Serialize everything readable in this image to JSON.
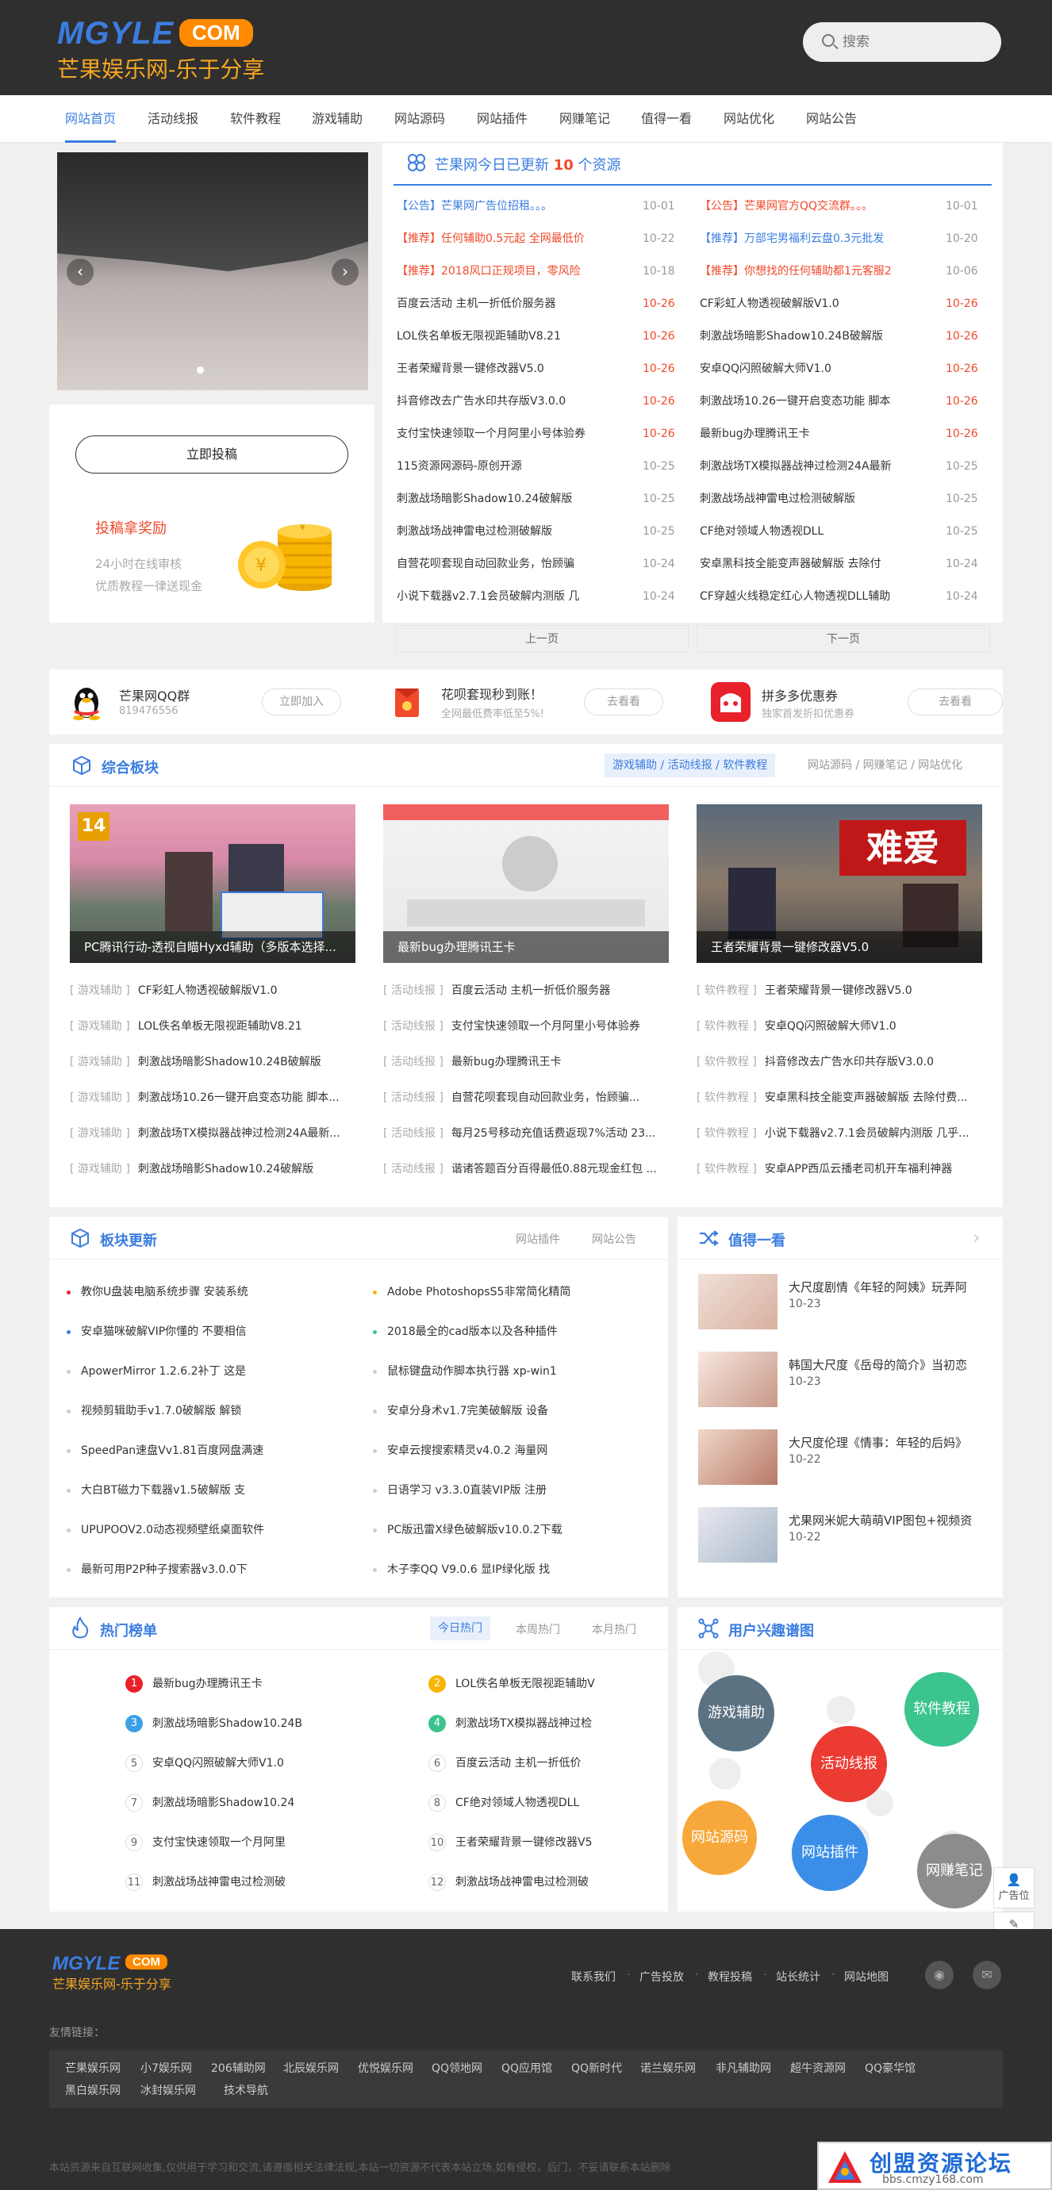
{
  "header": {
    "logo_main": "MGYLE",
    "logo_com": "COM",
    "logo_sub": "芒果娱乐网-乐于分享",
    "search_placeholder": "搜索"
  },
  "nav": [
    "网站首页",
    "活动线报",
    "软件教程",
    "游戏辅助",
    "网站源码",
    "网站插件",
    "网赚笔记",
    "值得一看",
    "网站优化",
    "网站公告"
  ],
  "submit": {
    "button": "立即投稿",
    "reward_title": "投稿拿奖励",
    "reward_desc1": "24小时在线审核",
    "reward_desc2": "优质教程一律送现金"
  },
  "updates": {
    "title_pre": "芒果网今日已更新",
    "count": "10",
    "title_post": "个资源",
    "left": [
      {
        "t": "【公告】芒果网广告位招租。。。",
        "d": "10-01",
        "c": "blue"
      },
      {
        "t": "【推荐】任何辅助0.5元起 全网最低价",
        "d": "10-22",
        "c": "red"
      },
      {
        "t": "【推荐】2018风口正规项目，零风险",
        "d": "10-18",
        "c": "red"
      },
      {
        "t": "百度云活动 主机一折低价服务器",
        "d": "10-26",
        "c": "new"
      },
      {
        "t": "LOL佚名单板无限视距辅助V8.21",
        "d": "10-26",
        "c": "new"
      },
      {
        "t": "王者荣耀背景一键修改器V5.0",
        "d": "10-26",
        "c": "new"
      },
      {
        "t": "抖音修改去广告水印共存版V3.0.0",
        "d": "10-26",
        "c": "new"
      },
      {
        "t": "支付宝快速领取一个月阿里小号体验券",
        "d": "10-26",
        "c": "new"
      },
      {
        "t": "115资源网源码-原创开源",
        "d": "10-25",
        "c": "old"
      },
      {
        "t": "刺激战场暗影Shadow10.24破解版",
        "d": "10-25",
        "c": "old"
      },
      {
        "t": "刺激战场战神雷电过检测破解版",
        "d": "10-25",
        "c": "old"
      },
      {
        "t": "自营花呗套现自动回款业务，怡顾骗",
        "d": "10-24",
        "c": "old"
      },
      {
        "t": "小说下载器v2.7.1会员破解内测版 几",
        "d": "10-24",
        "c": "old"
      }
    ],
    "right": [
      {
        "t": "【公告】芒果网官方QQ交流群。。。",
        "d": "10-01",
        "c": "red"
      },
      {
        "t": "【推荐】万部宅男福利云盘0.3元批发",
        "d": "10-20",
        "c": "blue"
      },
      {
        "t": "【推荐】你想找的任何辅助都1元客服2",
        "d": "10-06",
        "c": "red"
      },
      {
        "t": "CF彩虹人物透视破解版V1.0",
        "d": "10-26",
        "c": "new"
      },
      {
        "t": "刺激战场暗影Shadow10.24B破解版",
        "d": "10-26",
        "c": "new"
      },
      {
        "t": "安卓QQ闪照破解大师V1.0",
        "d": "10-26",
        "c": "new"
      },
      {
        "t": "刺激战场10.26一键开启变态功能 脚本",
        "d": "10-26",
        "c": "new"
      },
      {
        "t": "最新bug办理腾讯王卡",
        "d": "10-26",
        "c": "new"
      },
      {
        "t": "刺激战场TX模拟器战神过检测24A最新",
        "d": "10-25",
        "c": "old"
      },
      {
        "t": "刺激战场战神雷电过检测破解版",
        "d": "10-25",
        "c": "old"
      },
      {
        "t": "CF绝对领域人物透视DLL",
        "d": "10-25",
        "c": "old"
      },
      {
        "t": "安卓黑科技全能变声器破解版 去除付",
        "d": "10-24",
        "c": "old"
      },
      {
        "t": "CF穿越火线稳定红心人物透视DLL辅助",
        "d": "10-24",
        "c": "old"
      }
    ],
    "prev": "上一页",
    "next": "下一页"
  },
  "promos": [
    {
      "name": "芒果网QQ群",
      "sub": "819476556",
      "btn": "立即加入"
    },
    {
      "name": "花呗套现秒到账！",
      "sub": "全网最低费率低至5%!",
      "btn": "去看看"
    },
    {
      "name": "拼多多优惠券",
      "sub": "独家首发折扣优惠券",
      "btn": "去看看"
    }
  ],
  "combined": {
    "title": "综合板块",
    "tabs_active": "游戏辅助 / 活动线报 / 软件教程",
    "tabs_other": "网站源码 / 网赚笔记 / 网站优化",
    "thumbs": [
      "PC腾讯行动-透视自瞄Hyxd辅助（多版本选择...",
      "最新bug办理腾讯王卡",
      "王者荣耀背景一键修改器V5.0"
    ],
    "col1": [
      [
        "[ 游戏辅助 ]",
        "CF彩虹人物透视破解版V1.0"
      ],
      [
        "[ 游戏辅助 ]",
        "LOL佚名单板无限视距辅助V8.21"
      ],
      [
        "[ 游戏辅助 ]",
        "刺激战场暗影Shadow10.24B破解版"
      ],
      [
        "[ 游戏辅助 ]",
        "刺激战场10.26一键开启变态功能 脚本..."
      ],
      [
        "[ 游戏辅助 ]",
        "刺激战场TX模拟器战神过检测24A最新..."
      ],
      [
        "[ 游戏辅助 ]",
        "刺激战场暗影Shadow10.24破解版"
      ]
    ],
    "col2": [
      [
        "[ 活动线报 ]",
        "百度云活动 主机一折低价服务器"
      ],
      [
        "[ 活动线报 ]",
        "支付宝快速领取一个月阿里小号体验券"
      ],
      [
        "[ 活动线报 ]",
        "最新bug办理腾讯王卡"
      ],
      [
        "[ 活动线报 ]",
        "自营花呗套现自动回款业务，怡顾骗..."
      ],
      [
        "[ 活动线报 ]",
        "每月25号移动充值话费返现7%活动 23..."
      ],
      [
        "[ 活动线报 ]",
        "谐诸答题百分百得最低0.88元现金红包 ..."
      ]
    ],
    "col3": [
      [
        "[ 软件教程 ]",
        "王者荣耀背景一键修改器V5.0"
      ],
      [
        "[ 软件教程 ]",
        "安卓QQ闪照破解大师V1.0"
      ],
      [
        "[ 软件教程 ]",
        "抖音修改去广告水印共存版V3.0.0"
      ],
      [
        "[ 软件教程 ]",
        "安卓黑科技全能变声器破解版 去除付费..."
      ],
      [
        "[ 软件教程 ]",
        "小说下载器v2.7.1会员破解内测版 几乎..."
      ],
      [
        "[ 软件教程 ]",
        "安卓APP西瓜云播老司机开车福利神器"
      ]
    ]
  },
  "blockupd": {
    "title": "板块更新",
    "tab1": "网站插件",
    "tab2": "网站公告",
    "left": [
      "教你U盘装电脑系统步骤 安装系统",
      "安卓猫咪破解VIP你懂的 不要相信",
      "ApowerMirror 1.2.6.2补丁 这是",
      "视频剪辑助手v1.7.0破解版 解锁",
      "SpeedPan速盘Vv1.81百度网盘满速",
      "大白BT磁力下载器v1.5破解版 支",
      "UPUPOOV2.0动态视频壁纸桌面软件",
      "最新可用P2P种子搜索器v3.0.0下"
    ],
    "right": [
      "Adobe PhotoshopsS5非常简化精简",
      "2018最全的cad版本以及各种插件",
      "鼠标键盘动作脚本执行器 xp-win1",
      "安卓分身术v1.7完美破解版 设备",
      "安卓云搜搜索精灵v4.0.2 海量网",
      "日语学习 v3.3.0直装VIP版 注册",
      "PC版迅雷X绿色破解版v10.0.2下载",
      "木子李QQ V9.0.6 显IP绿化版 找"
    ]
  },
  "worth": {
    "title": "值得一看",
    "items": [
      [
        "大尺度剧情《年轻的阿姨》玩弄阿",
        "10-23"
      ],
      [
        "韩国大尺度《岳母的简介》当初恋",
        "10-23"
      ],
      [
        "大尺度伦理《情事：年轻的后妈》",
        "10-22"
      ],
      [
        "尤果网米妮大萌萌VIP图包+视频资",
        "10-22"
      ]
    ]
  },
  "hot": {
    "title": "热门榜单",
    "tab1": "今日热门",
    "tab2": "本周热门",
    "tab3": "本月热门",
    "items": [
      "最新bug办理腾讯王卡",
      "LOL佚名单板无限视距辅助V",
      "刺激战场暗影Shadow10.24B",
      "刺激战场TX模拟器战神过检",
      "安卓QQ闪照破解大师V1.0",
      "百度云活动 主机一折低价",
      "刺激战场暗影Shadow10.24",
      "CF绝对领域人物透视DLL",
      "支付宝快速领取一个月阿里",
      "王者荣耀背景一键修改器V5",
      "刺激战场战神雷电过检测破",
      "刺激战场战神雷电过检测破"
    ]
  },
  "interest": {
    "title": "用户兴趣谱图",
    "bubbles": [
      "游戏辅助",
      "软件教程",
      "活动线报",
      "网站源码",
      "网站插件",
      "网赚笔记"
    ]
  },
  "side": {
    "ad": "广告位",
    "submit": "投稿"
  },
  "footer": {
    "logo_main": "MGYLE",
    "logo_com": "COM",
    "logo_sub": "芒果娱乐网-乐于分享",
    "links": [
      "联系我们",
      "广告投放",
      "教程投稿",
      "站长统计",
      "网站地图"
    ],
    "friend_title": "友情链接：",
    "friends": [
      "芒果娱乐网",
      "小7娱乐网",
      "206辅助网",
      "北辰娱乐网",
      "优悦娱乐网",
      "QQ领地网",
      "QQ应用馆",
      "QQ新时代",
      "诺兰娱乐网",
      "非凡辅助网",
      "超牛资源网",
      "QQ豪华馆",
      "黑白娱乐网",
      "冰封娱乐网",
      "技术导航"
    ],
    "copyright": "本站资源来自互联网收集,仅供用于学习和交流,请遵循相关法律法规,本站一切资源不代表本站立场,如有侵权，后门，不妥请联系本站删除"
  },
  "watermark": {
    "main": "创盟资源论坛",
    "url": "bbs.cmzy168.com"
  },
  "colors": {
    "accent": "#3b7de0",
    "orange": "#ff8a00",
    "red": "#f04a2b",
    "dark": "#2f2f2f"
  }
}
